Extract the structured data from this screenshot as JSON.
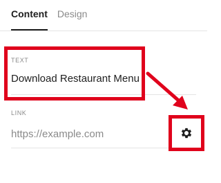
{
  "tabs": [
    {
      "label": "Content",
      "active": true
    },
    {
      "label": "Design",
      "active": false
    }
  ],
  "text_field": {
    "label": "TEXT",
    "value": "Download Restaurant Menu"
  },
  "link_field": {
    "label": "LINK",
    "placeholder": "https://example.com",
    "value": ""
  },
  "settings_button": {
    "icon": "gear-icon"
  },
  "colors": {
    "highlight": "#e0021c",
    "text": "#1e1e1e",
    "muted": "#8a8a8a",
    "divider": "#e4e4e4"
  }
}
